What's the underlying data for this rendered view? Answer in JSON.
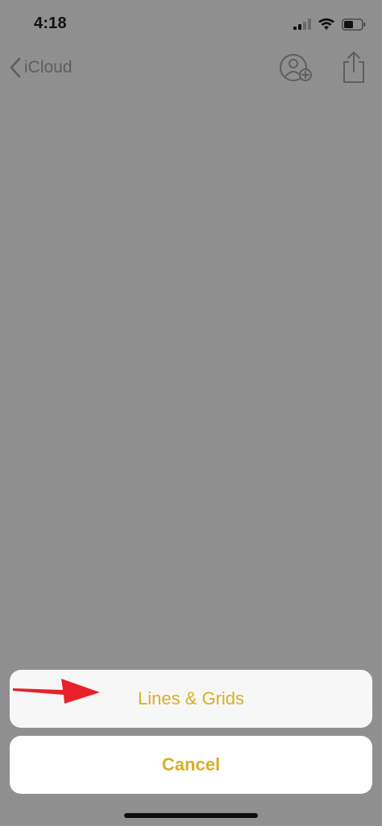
{
  "status_bar": {
    "time": "4:18",
    "icons": [
      "cellular-signal-icon",
      "wifi-icon",
      "battery-icon"
    ]
  },
  "nav_bar": {
    "back_label": "iCloud",
    "back_icon": "chevron-left-icon",
    "right_icons": [
      "add-person-icon",
      "share-icon"
    ]
  },
  "action_sheet": {
    "option_label": "Lines & Grids",
    "cancel_label": "Cancel"
  },
  "annotation": {
    "icon": "red-arrow-icon"
  },
  "colors": {
    "accent": "#d9ae27",
    "dim_overlay": "#8f8f8f",
    "sheet_background": "#f7f7f7",
    "arrow": "#e8202a"
  }
}
